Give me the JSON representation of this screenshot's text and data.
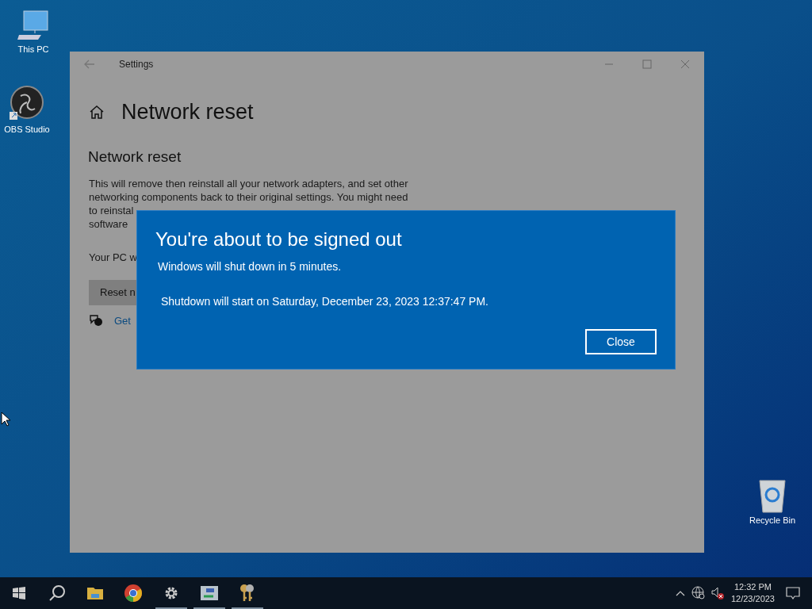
{
  "desktop_icons": [
    {
      "label": "This PC",
      "kind": "computer"
    },
    {
      "label": "OBS Studio",
      "kind": "obs"
    },
    {
      "label": "Recycle Bin",
      "kind": "recycle"
    }
  ],
  "settings_window": {
    "title": "Settings",
    "page_title": "Network reset",
    "section_title": "Network reset",
    "description_lines": [
      "This will remove then reinstall all your network adapters, and set other",
      "networking components back to their original settings. You might need",
      "to reinstal",
      "software"
    ],
    "status_text": "Your PC w",
    "reset_button": "Reset n",
    "help_link": "Get"
  },
  "dialog": {
    "title": "You're about to be signed out",
    "message": "Windows will shut down in 5 minutes.",
    "detail": "Shutdown will start on Saturday, December 23, 2023 12:37:47 PM.",
    "button": "Close"
  },
  "taskbar": {
    "items": [
      {
        "kind": "start",
        "active": false
      },
      {
        "kind": "search",
        "active": false
      },
      {
        "kind": "folder",
        "active": false
      },
      {
        "kind": "browser",
        "active": false
      },
      {
        "kind": "settings",
        "active": true
      },
      {
        "kind": "network-app",
        "active": true
      },
      {
        "kind": "keys",
        "active": true
      }
    ],
    "time": "12:32 PM",
    "date": "12/23/2023"
  }
}
